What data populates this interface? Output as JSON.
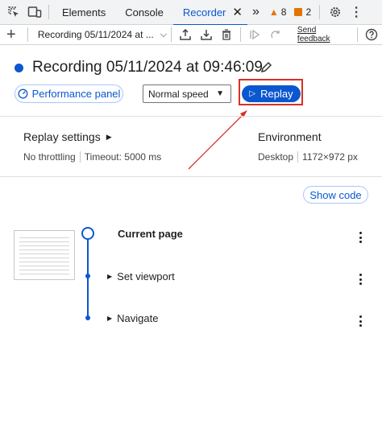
{
  "tabs": {
    "elements": "Elements",
    "console": "Console",
    "recorder": "Recorder",
    "more": "»"
  },
  "badges": {
    "warnings": "8",
    "issues": "2"
  },
  "toolbar": {
    "recording_select": "Recording 05/11/2024 at ...",
    "send_feedback": "Send feedback"
  },
  "recording": {
    "title": "Recording 05/11/2024 at 09:46:09",
    "performance_panel": "Performance panel",
    "speed": "Normal speed",
    "replay": "Replay"
  },
  "settings": {
    "replay_title": "Replay settings",
    "throttling": "No throttling",
    "timeout": "Timeout: 5000 ms",
    "environment_title": "Environment",
    "device": "Desktop",
    "viewport": "1172×972 px"
  },
  "steps": {
    "show_code": "Show code",
    "items": [
      {
        "label": "Current page"
      },
      {
        "label": "Set viewport"
      },
      {
        "label": "Navigate"
      }
    ]
  },
  "colors": {
    "accent": "#0b57d0",
    "highlight_red": "#d93025"
  }
}
